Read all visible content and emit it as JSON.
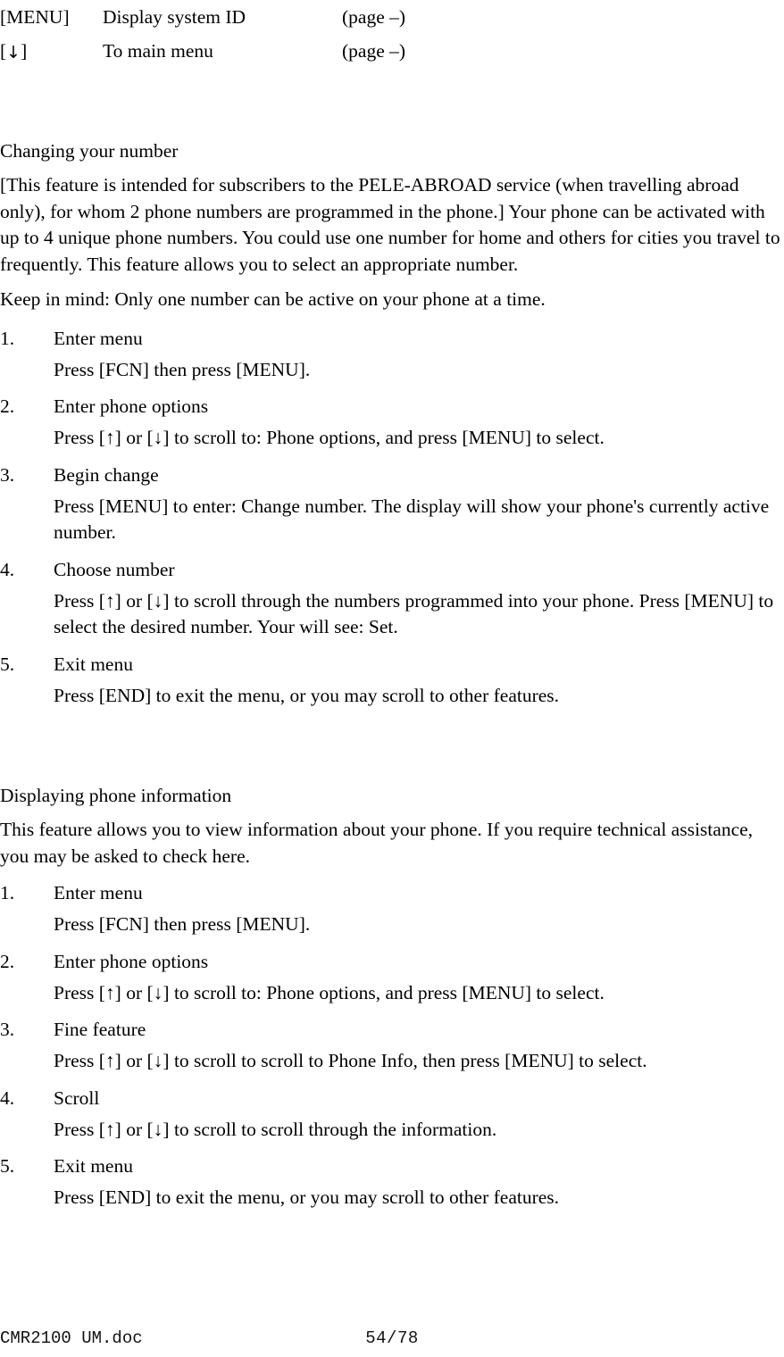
{
  "document": {
    "font_color": "#000000",
    "background": "#ffffff"
  },
  "xref_table": {
    "rows": [
      {
        "key": "[MENU]",
        "key_is_arrow": false,
        "label": "Display system ID",
        "page": "(page –)"
      },
      {
        "key": "[↓]",
        "key_is_arrow": true,
        "arrow": "↓",
        "label": "To main menu",
        "page": "(page –)"
      }
    ]
  },
  "sections": [
    {
      "heading": "Changing your number",
      "intro": "[This feature is intended for subscribers to the PELE-ABROAD service (when travelling abroad only), for whom 2 phone numbers are programmed in the phone.] Your phone can be activated with up to 4 unique phone numbers. You could use one number for home and others for cities you travel to frequently. This feature allows you to select an appropriate number.",
      "note": "Keep in mind:  Only one number can be active on your phone at a time.",
      "steps": [
        {
          "num": "1.",
          "title": "Enter menu",
          "body": "Press [FCN] then press [MENU]."
        },
        {
          "num": "2.",
          "title": "Enter phone options",
          "body": "Press [↑] or [↓] to scroll to: Phone options, and press [MENU] to select."
        },
        {
          "num": "3.",
          "title": "Begin change",
          "body": "Press [MENU] to enter: Change number. The display will show your phone's currently active number."
        },
        {
          "num": "4.",
          "title": "Choose number",
          "body": "Press [↑] or [↓] to scroll through the numbers programmed into your phone. Press [MENU] to select the desired number. Your will see: Set."
        },
        {
          "num": "5.",
          "title": "Exit menu",
          "body": "Press [END] to exit the menu, or you may scroll to other features."
        }
      ]
    },
    {
      "heading": "Displaying phone information",
      "intro": "This feature allows you to view information about your phone. If you require technical assistance, you may be asked to check here.",
      "note": "",
      "steps": [
        {
          "num": "1.",
          "title": "Enter menu",
          "body": "Press [FCN] then press [MENU]."
        },
        {
          "num": "2.",
          "title": "Enter phone options",
          "body": "Press [↑] or [↓] to scroll to: Phone options, and press [MENU] to select."
        },
        {
          "num": "3.",
          "title": "Fine feature",
          "body": "Press [↑] or [↓] to scroll to scroll to Phone Info, then press [MENU] to select."
        },
        {
          "num": "4.",
          "title": "Scroll",
          "body": "Press [↑] or [↓] to scroll to scroll through the information."
        },
        {
          "num": "5.",
          "title": "Exit menu",
          "body": "Press [END] to exit the menu, or you may scroll to other features."
        }
      ]
    }
  ],
  "footer": {
    "doc_name": "CMR2100 UM.doc",
    "page_number": "54/78"
  }
}
